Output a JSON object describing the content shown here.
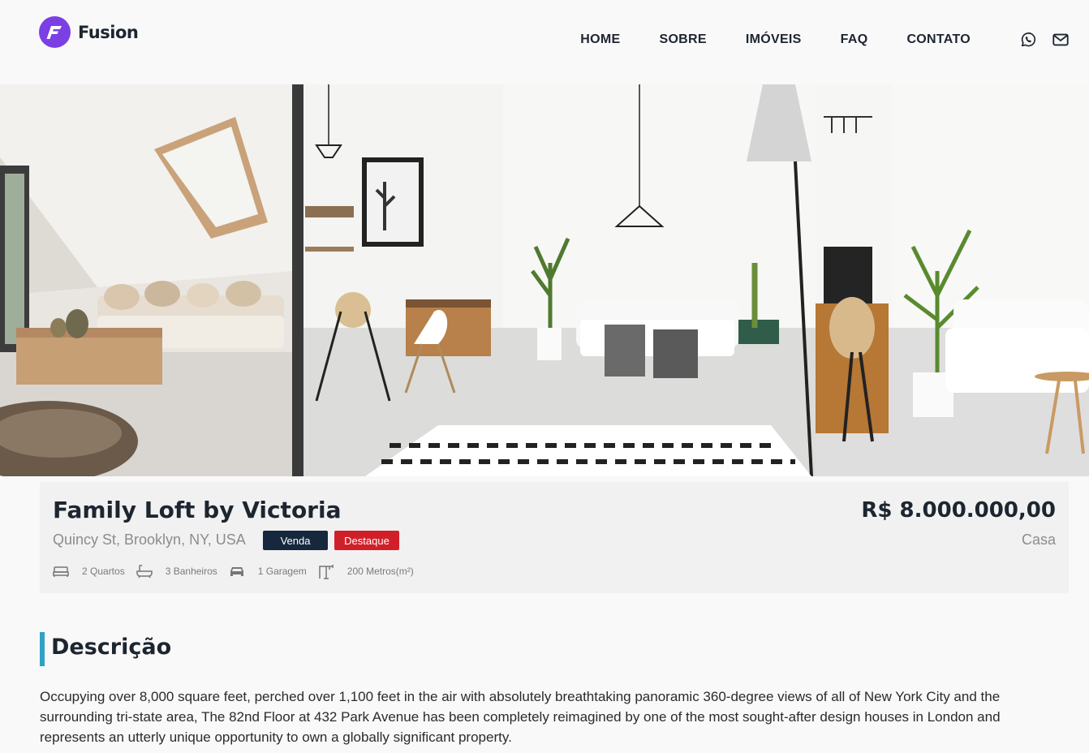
{
  "brand": {
    "name": "Fusion",
    "logo_color": "#7b3fe4"
  },
  "nav": {
    "items": [
      "HOME",
      "SOBRE",
      "IMÓVEIS",
      "FAQ",
      "CONTATO"
    ],
    "icons": [
      "whatsapp-icon",
      "mail-icon"
    ]
  },
  "gallery": {
    "images": [
      "living-room-skylight-photo",
      "open-plan-living-room-photo",
      "living-room-detail-photo"
    ]
  },
  "property": {
    "title": "Family Loft by Victoria",
    "address": "Quincy St, Brooklyn, NY, USA",
    "badges": {
      "sale": "Venda",
      "featured": "Destaque"
    },
    "badge_colors": {
      "sale": "#16283d",
      "featured": "#d11f29"
    },
    "price": "R$ 8.000.000,00",
    "type": "Casa",
    "features": {
      "bedrooms": "2 Quartos",
      "bathrooms": "3 Banheiros",
      "garage": "1 Garagem",
      "area": "200 Metros(m²)"
    }
  },
  "description": {
    "heading": "Descrição",
    "accent_color": "#2fa2c5",
    "text": "Occupying over 8,000 square feet, perched over 1,100 feet in the air with absolutely breathtaking panoramic 360-degree views of all of New York City and the surrounding tri-state area, The 82nd Floor at 432 Park Avenue has been completely reimagined by one of the most sought-after design houses in London and represents an utterly unique opportunity to own a globally significant property."
  }
}
